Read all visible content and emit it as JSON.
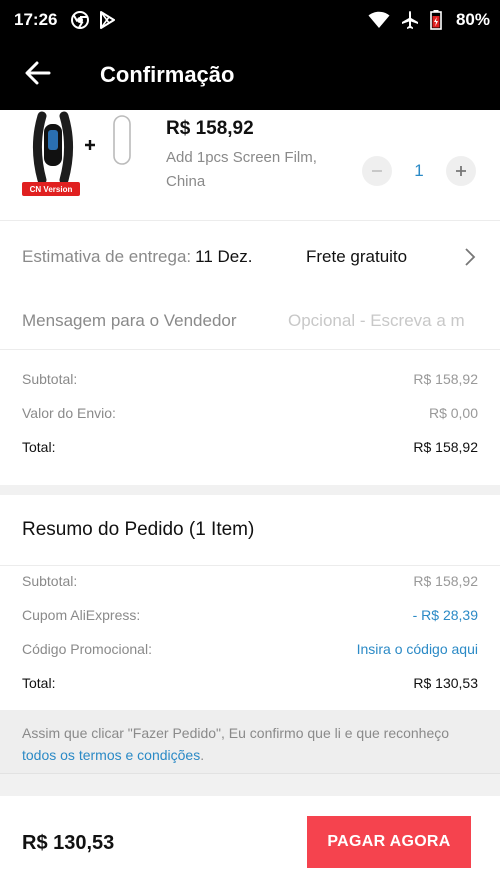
{
  "statusbar": {
    "time": "17:26",
    "battery": "80%"
  },
  "appbar": {
    "title": "Confirmação"
  },
  "product": {
    "badge": "CN Version",
    "price": "R$ 158,92",
    "variant": "Add 1pcs Screen Film, China",
    "quantity": "1"
  },
  "delivery": {
    "label": "Estimativa de entrega:",
    "date": "11 Dez.",
    "shipping": "Frete gratuito"
  },
  "message": {
    "label": "Mensagem para o Vendedor",
    "placeholder": "Opcional - Escreva a m"
  },
  "totals": {
    "subtotal_label": "Subtotal:",
    "subtotal_value": "R$ 158,92",
    "shipping_label": "Valor do Envio:",
    "shipping_value": "R$ 0,00",
    "total_label": "Total:",
    "total_value": "R$ 158,92"
  },
  "summary": {
    "heading": "Resumo do Pedido (1 Item)",
    "subtotal_label": "Subtotal:",
    "subtotal_value": "R$ 158,92",
    "coupon_label": "Cupom AliExpress:",
    "coupon_value": "- R$ 28,39",
    "promo_label": "Código Promocional:",
    "promo_value": "Insira o código aqui",
    "total_label": "Total:",
    "total_value": "R$ 130,53"
  },
  "terms": {
    "text": "Assim que clicar \"Fazer Pedido\", Eu confirmo que li e que reconheço ",
    "link": "todos os termos e condições",
    "end": "."
  },
  "footer": {
    "amount": "R$ 130,53",
    "pay_label": "PAGAR AGORA"
  },
  "colors": {
    "accent": "#f5434e",
    "link": "#2b8ac6",
    "badge": "#e02020"
  },
  "icons": [
    "chrome-icon",
    "play-store-icon",
    "wifi-icon",
    "airplane-icon",
    "battery-icon",
    "back-arrow-icon",
    "chevron-right-icon",
    "minus-icon",
    "plus-icon"
  ]
}
